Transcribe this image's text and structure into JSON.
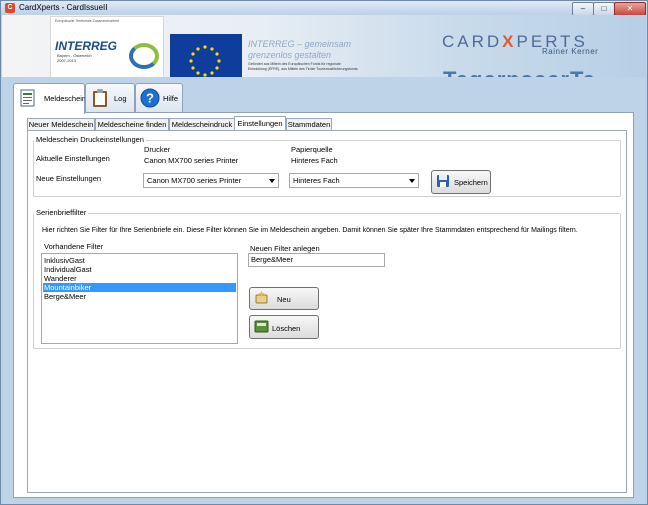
{
  "window": {
    "title": "CardXperts - CardIssueII",
    "controls": {
      "minimize": "–",
      "maximize": "□",
      "close": "✕"
    },
    "close_color": "#c9463d"
  },
  "banner": {
    "interreg_word": "INTERREG",
    "interreg_sub": "Bayern - Österreich\n2007-2013",
    "eu_slogan": "INTERREG – gemeinsam\ngrenzenlos gestalten",
    "eu_note": "Gefördert aus Mitteln des Europäischen Fonds für regionale Entwicklung (EFRE), aus Mitteln des Tiroler Tourismusförderungsfonds",
    "logo_a": "CARD",
    "logo_x": "X",
    "logo_b": "PERTS",
    "logo_sub": "Rainer Kerner",
    "tegernsee": "TegernseerTa"
  },
  "main_tabs": [
    {
      "label": "Meldeschein",
      "icon": "form-icon",
      "active": true
    },
    {
      "label": "Log",
      "icon": "clipboard-icon",
      "active": false
    },
    {
      "label": "Hilfe",
      "icon": "help-icon",
      "active": false
    }
  ],
  "sub_tabs": [
    {
      "label": "Neuer Meldeschein"
    },
    {
      "label": "Meldescheine finden"
    },
    {
      "label": "Meldescheindruck"
    },
    {
      "label": "Einstellungen",
      "active": true
    },
    {
      "label": "Stammdaten"
    }
  ],
  "print_settings": {
    "group_title": "Meldeschein Druckeinstellungen",
    "col_printer": "Drucker",
    "col_tray": "Papierquelle",
    "current_label": "Aktuelle Einstellungen",
    "current_printer": "Canon MX700 series Printer",
    "current_tray": "Hinteres Fach",
    "new_label": "Neue Einstellungen",
    "new_printer": "Canon MX700 series Printer",
    "new_tray": "Hinteres Fach",
    "save_label": "Speichern"
  },
  "serial_filter": {
    "group_title": "Serienbrieffilter",
    "description": "Hier richten Sie Filter für Ihre Serienbriefe ein. Diese Filter können Sie im Meldeschein angeben. Damit können Sie später Ihre Stammdaten entsprechend für Mailings filtern.",
    "existing_label": "Vorhandene Filter",
    "filters": [
      "InklusivGast",
      "IndividualGast",
      "Wanderer",
      "Mountainbiker",
      "Berge&Meer"
    ],
    "selected_index": 3,
    "new_label": "Neuen Filter anlegen",
    "new_value": "Berge&Meer",
    "new_button": "Neu",
    "delete_button": "Löschen"
  }
}
